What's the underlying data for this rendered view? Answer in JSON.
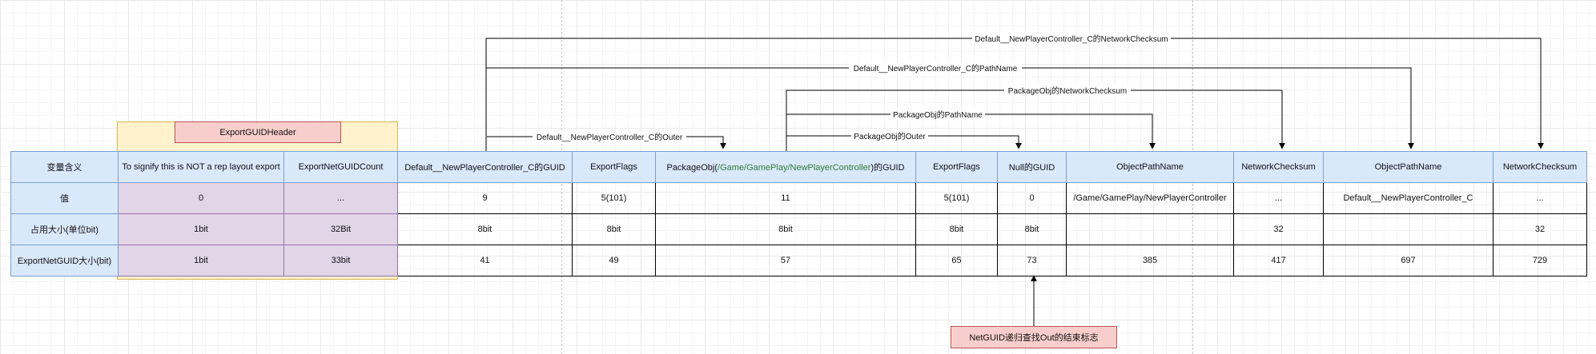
{
  "header_group": {
    "label": "ExportGUIDHeader"
  },
  "note": {
    "label": "NetGUID递归查找Out的结束标志"
  },
  "table": {
    "headers": [
      "变量含义",
      "To signify this is NOT a rep layout export",
      "ExportNetGUIDCount",
      "Default__NewPlayerController_C的GUID",
      "ExportFlags",
      {
        "prefix": "PackageObj(",
        "green": "/Game/GamePlay/NewPlayerController",
        "suffix": ")的GUID"
      },
      "ExportFlags",
      "Null的GUID",
      "ObjectPathName",
      "NetworkChecksum",
      "ObjectPathName",
      "NetworkChecksum"
    ],
    "rows": [
      [
        "值",
        "0",
        "...",
        "9",
        "5(101)",
        "11",
        "5(101)",
        "0",
        "/Game/GamePlay/NewPlayerController",
        "...",
        "Default__NewPlayerController_C",
        "..."
      ],
      [
        "占用大小(单位bit)",
        "1bit",
        "32Bit",
        "8bit",
        "8bit",
        "8bit",
        "8bit",
        "8bit",
        "",
        "32",
        "",
        "32"
      ],
      [
        "ExportNetGUID大小(bit)",
        "1bit",
        "33bit",
        "41",
        "49",
        "57",
        "65",
        "73",
        "385",
        "417",
        "697",
        "729"
      ]
    ]
  },
  "edges": [
    {
      "label": "Default__NewPlayerController_C的NetworkChecksum"
    },
    {
      "label": "Default__NewPlayerController_C的PathName"
    },
    {
      "label": "PackageObj的NetworkChecksum"
    },
    {
      "label": "PackageObj的PathName"
    },
    {
      "label": "PackageObj的Outer"
    },
    {
      "label": "Default__NewPlayerController_C的Outer"
    }
  ]
}
